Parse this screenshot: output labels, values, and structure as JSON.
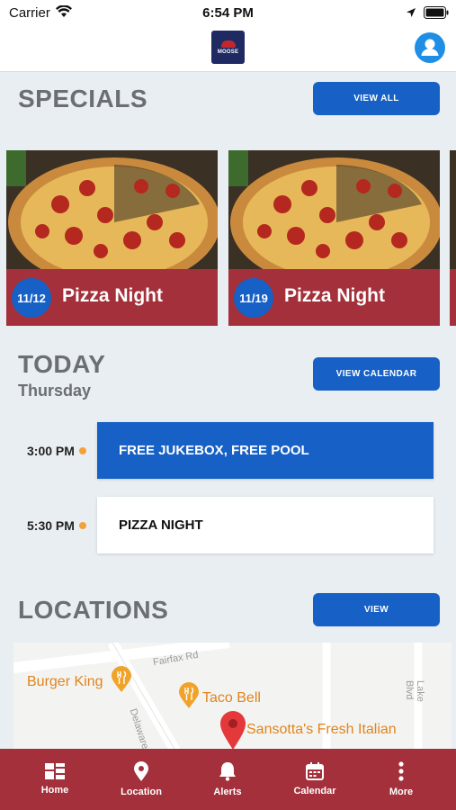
{
  "status_bar": {
    "carrier": "Carrier",
    "time": "6:54 PM"
  },
  "header": {
    "logo_text": "MOOSE"
  },
  "specials": {
    "title": "SPECIALS",
    "view_all_label": "VIEW ALL",
    "cards": [
      {
        "date": "11/12",
        "title": "Pizza Night"
      },
      {
        "date": "11/19",
        "title": "Pizza Night"
      }
    ]
  },
  "today": {
    "title": "TODAY",
    "weekday": "Thursday",
    "view_calendar_label": "VIEW CALENDAR",
    "events": [
      {
        "time": "3:00 PM",
        "title": "FREE JUKEBOX, FREE POOL"
      },
      {
        "time": "5:30 PM",
        "title": "PIZZA NIGHT"
      }
    ]
  },
  "locations": {
    "title": "LOCATIONS",
    "view_label": "VIEW",
    "map": {
      "places": [
        "Burger King",
        "Taco Bell",
        "Sansotta's Fresh Italian"
      ],
      "streets": [
        "Fairfax Rd",
        "Delaware A",
        "Lake Blvd"
      ]
    }
  },
  "tab_bar": {
    "items": [
      {
        "label": "Home",
        "icon": "home-grid-icon"
      },
      {
        "label": "Location",
        "icon": "map-pin-icon"
      },
      {
        "label": "Alerts",
        "icon": "bell-icon"
      },
      {
        "label": "Calendar",
        "icon": "calendar-icon"
      },
      {
        "label": "More",
        "icon": "more-vertical-icon"
      }
    ]
  },
  "colors": {
    "brand_blue": "#1660c6",
    "brand_red": "#a3303a",
    "event_dot": "#f2a23a",
    "map_label": "#e0841b"
  }
}
